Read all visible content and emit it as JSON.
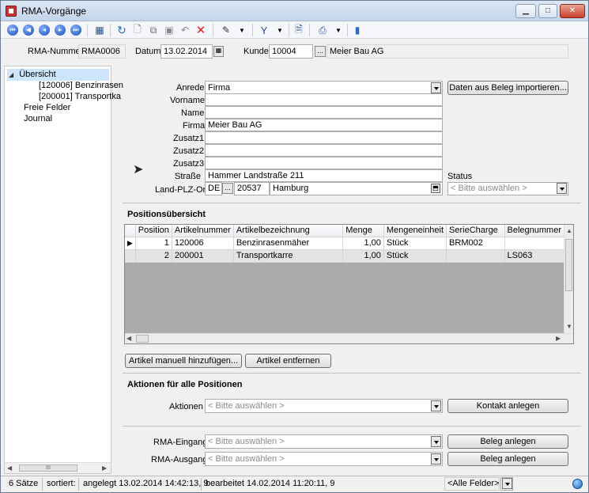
{
  "window": {
    "title": "RMA-Vorgänge"
  },
  "header": {
    "rma_label": "RMA-Nummer",
    "rma_value": "RMA0006",
    "datum_label": "Datum",
    "datum_value": "13.02.2014",
    "kunde_label": "Kunde",
    "kunde_value": "10004",
    "kunde_name": "Meier Bau AG",
    "lookup_btn": "..."
  },
  "nav": {
    "items": [
      {
        "label": "Übersicht"
      },
      {
        "label": "[120006]  Benzinrasen"
      },
      {
        "label": "[200001]  Transportka"
      },
      {
        "label": "Freie Felder"
      },
      {
        "label": "Journal"
      }
    ],
    "scroll_thumb": "III"
  },
  "form": {
    "anrede_label": "Anrede",
    "anrede_value": "Firma",
    "vorname_label": "Vorname",
    "vorname_value": "",
    "name_label": "Name",
    "name_value": "",
    "firma_label": "Firma",
    "firma_value": "Meier Bau AG",
    "zusatz1_label": "Zusatz1",
    "zusatz2_label": "Zusatz2",
    "zusatz3_label": "Zusatz3",
    "strasse_label": "Straße",
    "strasse_value": "Hammer Landstraße  211",
    "land_label": "Land-PLZ-Ort",
    "land_value": "DE",
    "plz_value": "20537",
    "ort_value": "Hamburg",
    "status_label": "Status",
    "status_placeholder": "< Bitte auswählen >",
    "import_btn": "Daten aus Beleg importieren..."
  },
  "positions": {
    "title": "Positionsübersicht",
    "columns": [
      "Position",
      "Artikelnummer",
      "Artikelbezeichnung",
      "Menge",
      "Mengeneinheit",
      "SerieCharge",
      "Belegnummer"
    ],
    "rows": [
      [
        "1",
        "120006",
        "Benzinrasenmäher",
        "1,00",
        "Stück",
        "BRM002",
        ""
      ],
      [
        "2",
        "200001",
        "Transportkarre",
        "1,00",
        "Stück",
        "",
        "LS063"
      ]
    ],
    "add_btn": "Artikel manuell hinzufügen...",
    "remove_btn": "Artikel entfernen"
  },
  "actions": {
    "title": "Aktionen für alle Positionen",
    "aktionen_label": "Aktionen",
    "aktionen_placeholder": "< Bitte auswählen >",
    "kontakt_btn": "Kontakt anlegen",
    "eingang_label": "RMA-Eingang",
    "eingang_placeholder": "< Bitte auswählen >",
    "ausgang_label": "RMA-Ausgang",
    "ausgang_placeholder": "< Bitte auswählen >",
    "beleg_btn": "Beleg anlegen"
  },
  "statusbar": {
    "count": "6 Sätze",
    "sorted": "sortiert:",
    "created": "angelegt 13.02.2014 14:42:13,  9",
    "edited": "bearbeitet 14.02.2014 11:20:11,  9",
    "filter": "<Alle Felder>"
  }
}
